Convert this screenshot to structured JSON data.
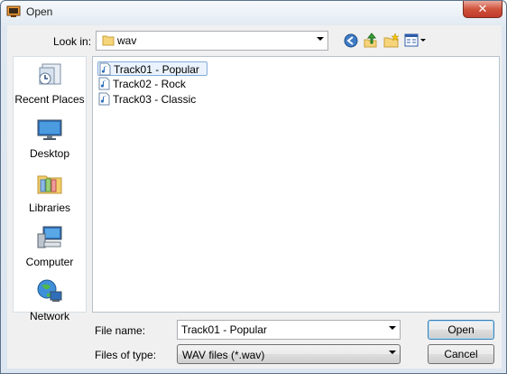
{
  "window": {
    "title": "Open",
    "close_label": "✕"
  },
  "toolbar": {
    "look_in_label": "Look in:",
    "look_in_value": "wav",
    "buttons": [
      "back-icon",
      "up-folder-icon",
      "new-folder-icon",
      "view-menu-icon"
    ]
  },
  "places": [
    {
      "label": "Recent Places",
      "icon": "recent-places-icon"
    },
    {
      "label": "Desktop",
      "icon": "desktop-icon"
    },
    {
      "label": "Libraries",
      "icon": "libraries-icon"
    },
    {
      "label": "Computer",
      "icon": "computer-icon"
    },
    {
      "label": "Network",
      "icon": "network-icon"
    }
  ],
  "files": [
    {
      "name": "Track01 - Popular",
      "selected": true
    },
    {
      "name": "Track02 - Rock",
      "selected": false
    },
    {
      "name": "Track03 - Classic",
      "selected": false
    }
  ],
  "form": {
    "file_name_label": "File name:",
    "file_name_value": "Track01 - Popular",
    "files_of_type_label": "Files of type:",
    "files_of_type_value": "WAV files (*.wav)"
  },
  "buttons": {
    "open": "Open",
    "cancel": "Cancel"
  },
  "colors": {
    "selection": "#eaf3fd",
    "selection_border": "#84acdd",
    "close": "#c0392b"
  }
}
